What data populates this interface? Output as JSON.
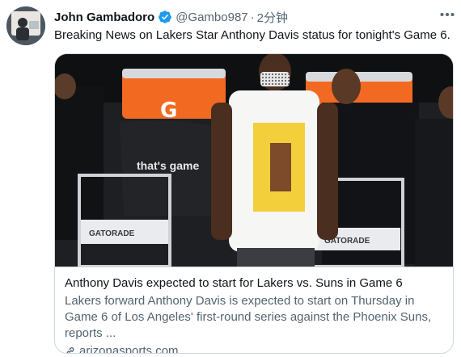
{
  "author": {
    "name": "John Gambadoro",
    "handle": "@Gambo987",
    "separator": "·",
    "time": "2分钟"
  },
  "tweet": {
    "text": "Breaking News on Lakers Star Anthony Davis status for tonight's Game 6."
  },
  "card": {
    "image_text": {
      "thats_game": "that's game",
      "gatorade_left": "GATORADE",
      "gatorade_right": "GATORADE"
    },
    "title": "Anthony Davis expected to start for Lakers vs. Suns in Game 6",
    "description": "Lakers forward Anthony Davis is expected to start on Thursday in Game 6 of Los Angeles' first-round series against the Phoenix Suns, reports ...",
    "domain": "arizonasports.com"
  },
  "colors": {
    "verified_badge": "#1d9bf0",
    "secondary_text": "#536471",
    "gatorade_orange": "#f26a21"
  },
  "icons": {
    "verified": "verified-badge-icon",
    "more": "more-options-icon",
    "link": "link-icon"
  }
}
